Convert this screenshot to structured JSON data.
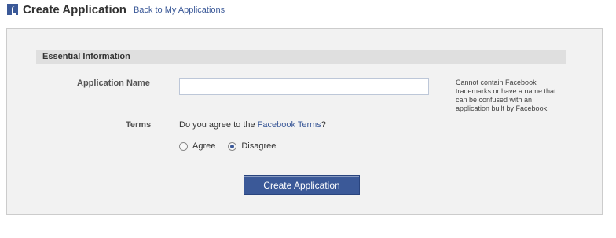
{
  "header": {
    "title": "Create Application",
    "back_link": "Back to My Applications",
    "icon": "facebook-developer-icon"
  },
  "form": {
    "section_title": "Essential Information",
    "app_name_label": "Application Name",
    "app_name_value": "",
    "app_name_hint": "Cannot contain Facebook trademarks or have a name that can be confused with an application built by Facebook.",
    "terms_label": "Terms",
    "terms_question_prefix": "Do you agree to the ",
    "terms_link": "Facebook Terms",
    "terms_question_suffix": "?",
    "options": [
      {
        "label": "Agree",
        "selected": false
      },
      {
        "label": "Disagree",
        "selected": true
      }
    ],
    "submit_label": "Create Application"
  },
  "colors": {
    "brand": "#3b5998",
    "panel_bg": "#f2f2f2",
    "section_bg": "#dfdfdf"
  }
}
